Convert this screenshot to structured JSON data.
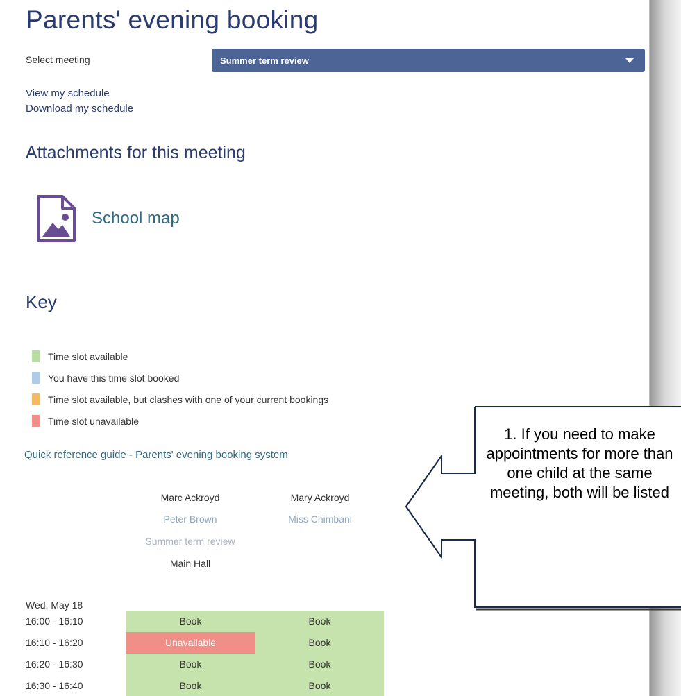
{
  "page": {
    "title": "Parents' evening booking",
    "select_meeting_label": "Select meeting",
    "selected_meeting": "Summer term review",
    "view_schedule": "View my schedule",
    "download_schedule": "Download my schedule"
  },
  "attachments": {
    "heading": "Attachments for this meeting",
    "items": [
      {
        "label": "School map",
        "icon": "image-file-icon"
      }
    ]
  },
  "key": {
    "heading": "Key",
    "items": [
      {
        "label": "Time slot available",
        "color": "#b8dda0"
      },
      {
        "label": "You have this time slot booked",
        "color": "#aecbe8"
      },
      {
        "label": "Time slot available, but clashes with one of your current bookings",
        "color": "#f5b865"
      },
      {
        "label": "Time slot unavailable",
        "color": "#ef8f87"
      }
    ]
  },
  "quick_reference": "Quick reference guide - Parents' evening booking system",
  "schedule_header": {
    "columns": [
      {
        "student": "Marc Ackroyd",
        "teacher": "Peter Brown",
        "meeting": "Summer term review",
        "location": "Main Hall"
      },
      {
        "student": "Mary Ackroyd",
        "teacher": "Miss Chimbani"
      }
    ]
  },
  "schedule": {
    "day": "Wed, May 18",
    "rows": [
      {
        "time": "16:00 - 16:10",
        "slots": [
          "Book",
          "Book"
        ],
        "status": [
          "available",
          "available"
        ]
      },
      {
        "time": "16:10 - 16:20",
        "slots": [
          "Unavailable",
          "Book"
        ],
        "status": [
          "unavailable",
          "available"
        ]
      },
      {
        "time": "16:20 - 16:30",
        "slots": [
          "Book",
          "Book"
        ],
        "status": [
          "available",
          "available"
        ]
      },
      {
        "time": "16:30 - 16:40",
        "slots": [
          "Book",
          "Book"
        ],
        "status": [
          "available",
          "available"
        ]
      }
    ]
  },
  "colors": {
    "available": "#c6e2ad",
    "unavailable": "#ef8f87",
    "heading": "#2a3b6f",
    "select_bg": "#4d6496",
    "link_teal": "#2f6c84",
    "muted_teacher": "#8fa6bd"
  },
  "callout": {
    "text": "1.  If you need to make appointments for more than one child at the same meeting, both will be listed"
  }
}
